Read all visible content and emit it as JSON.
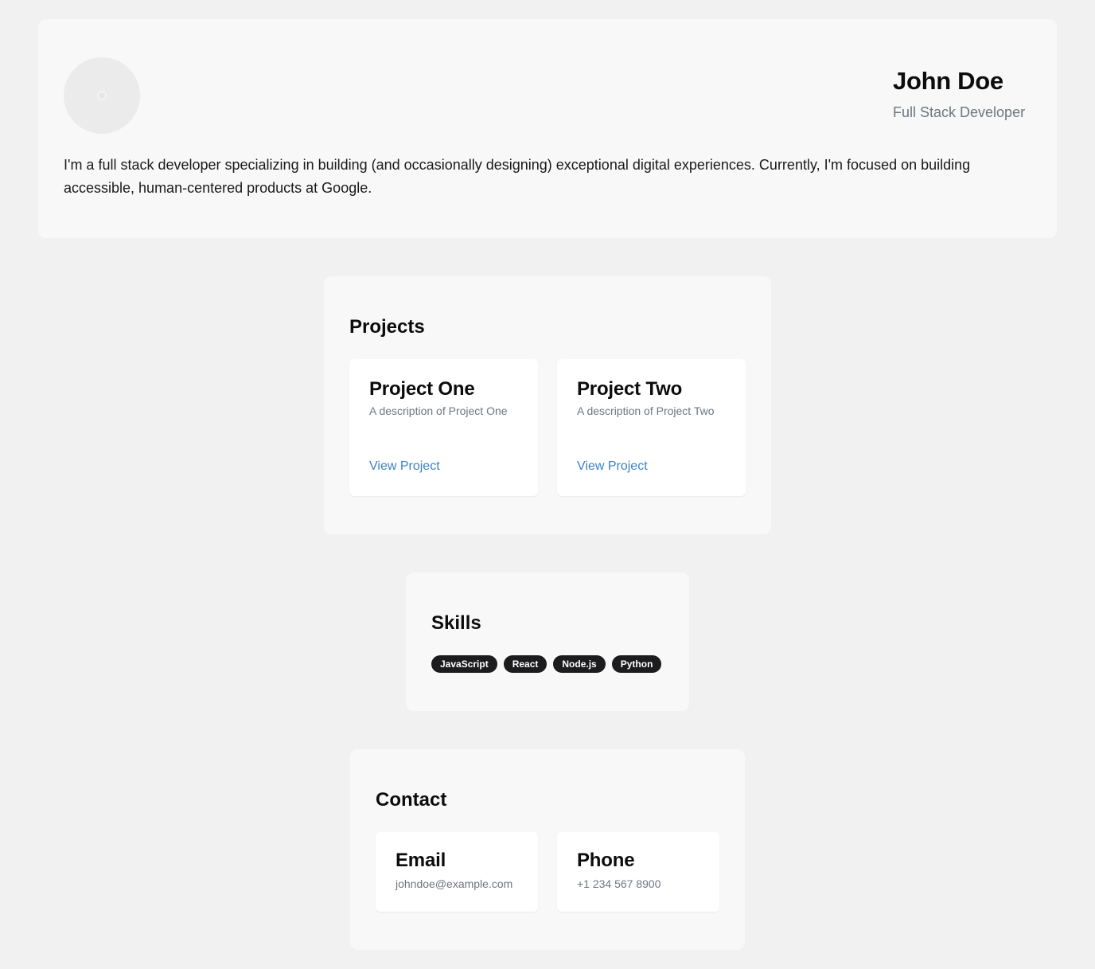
{
  "profile": {
    "name": "John Doe",
    "title": "Full Stack Developer",
    "bio": "I'm a full stack developer specializing in building (and occasionally designing) exceptional digital experiences. Currently, I'm focused on building accessible, human-centered products at Google."
  },
  "projects": {
    "heading": "Projects",
    "items": [
      {
        "title": "Project One",
        "description": "A description of Project One",
        "link_label": "View Project"
      },
      {
        "title": "Project Two",
        "description": "A description of Project Two",
        "link_label": "View Project"
      }
    ]
  },
  "skills": {
    "heading": "Skills",
    "items": [
      "JavaScript",
      "React",
      "Node.js",
      "Python"
    ]
  },
  "contact": {
    "heading": "Contact",
    "email": {
      "label": "Email",
      "value": "johndoe@example.com"
    },
    "phone": {
      "label": "Phone",
      "value": "+1 234 567 8900"
    }
  },
  "colors": {
    "background": "#f1f1f1",
    "card": "#f8f8f8",
    "link": "#3b82c4",
    "badge": "#1c1c1e",
    "muted_text": "#6f7580"
  },
  "icons": {
    "avatar": "avatar-placeholder-icon"
  }
}
